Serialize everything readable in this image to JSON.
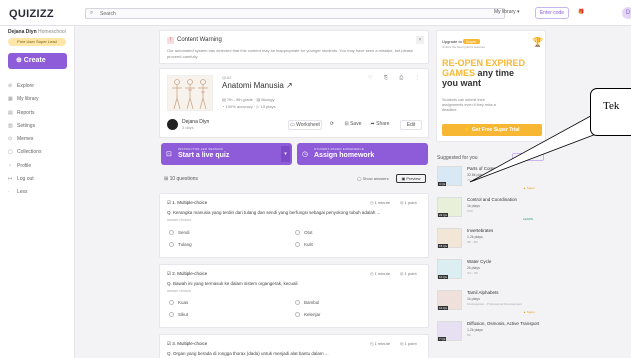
{
  "topbar": {
    "logo": "QUIZIZZ",
    "search_placeholder": "Search",
    "my_library": "My library ▾",
    "enter_code": "Enter code",
    "gift": "🎁",
    "avatar_letter": "D"
  },
  "sidebar": {
    "user_name": "Dejana Diyn",
    "org": "Homeschool",
    "badge": "Free User Super Lead",
    "create_label": "⊕ Create",
    "items": [
      {
        "icon": "⊘",
        "label": "Explore"
      },
      {
        "icon": "▦",
        "label": "My library"
      },
      {
        "icon": "▤",
        "label": "Reports"
      },
      {
        "icon": "▥",
        "label": "Settings"
      },
      {
        "icon": "⊙",
        "label": "Memes"
      },
      {
        "icon": "▢",
        "label": "Collections"
      },
      {
        "icon": "◔",
        "label": "Profile"
      },
      {
        "icon": "↦",
        "label": "Log out"
      },
      {
        "icon": "·",
        "label": "Less"
      }
    ]
  },
  "warning": {
    "title": "Content Warning",
    "text": "Our automated system has detected that this content may be inappropriate for younger students. You may have seen a mistake, but please proceed carefully.",
    "close": "×"
  },
  "quiz": {
    "type": "QUIZ",
    "title": "Anatomi Manusia ↗",
    "meta1": "▤ 7th - 9th grade · ▤ Biology",
    "meta2": "◔ 100% accuracy · ▷ 15 plays",
    "action_icons": "♡ ⎘ ⎙ ⋮",
    "owner": "Dejana Diyn",
    "owner_sub": "3 days",
    "worksheet": "▭ Worksheet",
    "edit_icon": "⟳",
    "save": "⊟ Save",
    "share": "➦ Share",
    "edit": "Edit"
  },
  "cta": {
    "live_small": "INSTRUCTOR-LED SESSION",
    "live_big": "Start a live quiz",
    "assign_small": "STUDENT-PACED EXPERIENCE",
    "assign_big": "Assign homework",
    "chev": "▾"
  },
  "questions_header": {
    "count": "⊞ 10 questions",
    "show_answers": "◯ Show answers",
    "preview": "▣ Preview"
  },
  "questions": [
    {
      "label": "☑ 1. Multiple-choice",
      "time": "◷ 1 minute",
      "points": "◎ 1 point",
      "text": "Q. Kerangka manusia yang terdiri dari tulang dan sendi yang berfungsi sebagai penyokong tubuh adalah ...",
      "sub": "answer choices",
      "options": [
        "Sendi",
        "Otot",
        "Tulang",
        "Kulit"
      ]
    },
    {
      "label": "☑ 2. Multiple-choice",
      "time": "◷ 1 minute",
      "points": "◎ 1 point",
      "text": "Q. Bawah ini yang termasuk ke dalam sistem organgerak, kecuali",
      "sub": "answer choices",
      "options": [
        "Kuas",
        "Bambul",
        "Sikut",
        "Kelenjar"
      ]
    },
    {
      "label": "☑ 3. Multiple-choice",
      "time": "◷ 1 minute",
      "points": "◎ 1 point",
      "text": "Q. Organ yang berada di rongga thorax (dada) untuk menjadi alat bantu dalam ...",
      "sub": "",
      "options": []
    }
  ],
  "panel": {
    "upgrade": "Upgrade to",
    "pill": "Super",
    "upgrade_line": "Unlock the best Quizizz features",
    "trophy": "🏆",
    "headline1": "RE-OPEN EXPIRED",
    "headline2": "GAMES any time",
    "headline3": "you want",
    "sub": "Students can submit their assignments even if they miss a deadline.",
    "button": "⚡ Get Free Super Trial"
  },
  "suggestions": {
    "title": "Suggested for you",
    "see_more": "See more ›",
    "items": [
      {
        "title": "Parts of Computer",
        "plays": "32.8k plays",
        "grade": "7th",
        "count": "4 Qs",
        "tag": "▲ Super",
        "tag_color": "#e0a020"
      },
      {
        "title": "Control and Coordination",
        "plays": "1k plays",
        "grade": "10th",
        "count": "22 Qs",
        "tag": "LEARN",
        "tag_color": "#1b9e7a"
      },
      {
        "title": "Invertebrates",
        "plays": "1.2k plays",
        "grade": "5th - 8th",
        "count": "15 Qs",
        "tag": "",
        "tag_color": "#e0a020"
      },
      {
        "title": "Water Cycle",
        "plays": "2k plays",
        "grade": "3rd - 5th",
        "count": "10 Qs",
        "tag": "",
        "tag_color": "#e0a020"
      },
      {
        "title": "Tamil Alphabets",
        "plays": "1k plays",
        "grade": "Kindergarten - Professional Development",
        "count": "10 Qs",
        "tag": "▲ Super",
        "tag_color": "#e0a020"
      },
      {
        "title": "Diffusion, Osmosis, Active Transport",
        "plays": "1.2k plays",
        "grade": "8th",
        "count": "7 Qs",
        "tag": "",
        "tag_color": "#e0a020"
      }
    ]
  },
  "callout": {
    "text": "Tek"
  },
  "colors": {
    "brand": "#8e5cd9",
    "accent": "#f7b733",
    "warning": "#d04545"
  }
}
